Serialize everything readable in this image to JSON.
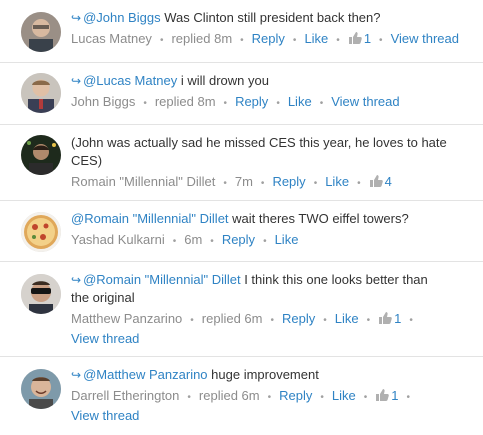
{
  "comments": [
    {
      "mention": "@John Biggs",
      "text": " Was Clinton still president back then?",
      "author": "Lucas Matney",
      "relation": "replied 8m",
      "reply": "Reply",
      "like": "Like",
      "likes": "1",
      "view_thread": "View thread"
    },
    {
      "mention": "@Lucas Matney",
      "text": " i will drown you",
      "author": "John Biggs",
      "relation": "replied 8m",
      "reply": "Reply",
      "like": "Like",
      "view_thread": "View thread"
    },
    {
      "text_line1": "(John was actually sad he missed CES this year, he loves to hate",
      "text_line2": "CES)",
      "author": "Romain \"Millennial\" Dillet",
      "relation": "7m",
      "reply": "Reply",
      "like": "Like",
      "likes": "4"
    },
    {
      "mention": "@Romain \"Millennial\" Dillet",
      "text": " wait theres TWO eiffel towers?",
      "author": "Yashad Kulkarni",
      "relation": "6m",
      "reply": "Reply",
      "like": "Like"
    },
    {
      "mention": "@Romain \"Millennial\" Dillet",
      "text_line1": " I think this one looks better than",
      "text_line2": "the original",
      "author": "Matthew Panzarino",
      "relation": "replied 6m",
      "reply": "Reply",
      "like": "Like",
      "likes": "1",
      "view_thread": "View thread"
    },
    {
      "mention": "@Matthew Panzarino",
      "text": " huge improvement",
      "author": "Darrell Etherington",
      "relation": "replied 6m",
      "reply": "Reply",
      "like": "Like",
      "likes": "1",
      "view_thread": "View thread"
    }
  ],
  "icons": {
    "reply": "reply-arrow-icon",
    "like": "thumbs-up-icon"
  },
  "colors": {
    "link": "#2f83c4",
    "meta": "#8c8c8c",
    "divider": "#e3e3e3"
  }
}
